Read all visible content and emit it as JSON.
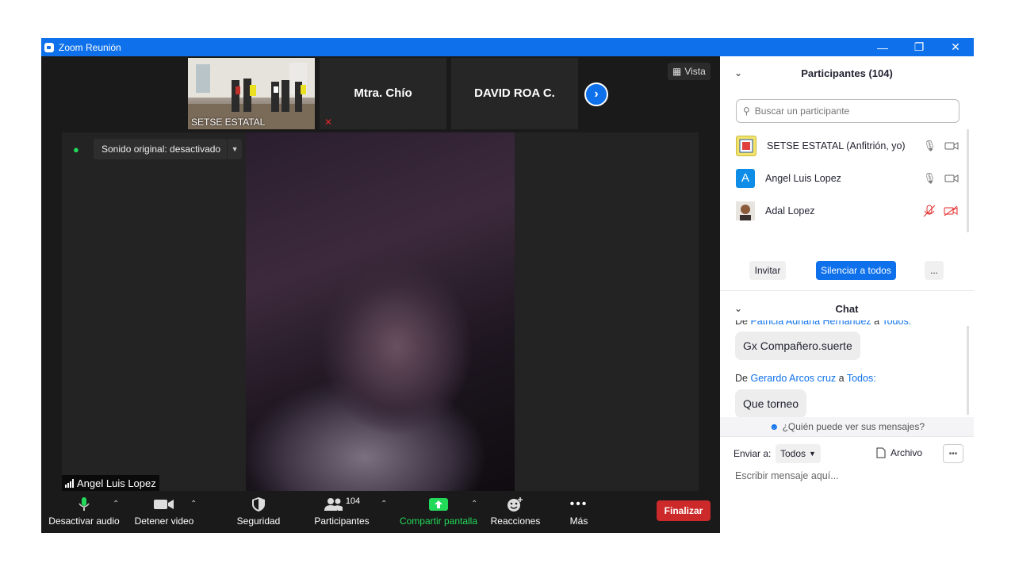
{
  "window": {
    "title": "Zoom Reunión"
  },
  "thumbnails": [
    {
      "label": "SETSE ESTATAL"
    },
    {
      "name": "Mtra. Chío"
    },
    {
      "name": "DAVID ROA C."
    }
  ],
  "view_button": {
    "label": "Vista"
  },
  "stage": {
    "sound_label": "Sonido original: desactivado",
    "speaker_name": "Angel Luis Lopez"
  },
  "toolbar": {
    "audio_label": "Desactivar audio",
    "video_label": "Detener video",
    "security_label": "Seguridad",
    "participants_label": "Participantes",
    "participants_count": "104",
    "share_label": "Compartir pantalla",
    "reactions_label": "Reacciones",
    "more_label": "Más",
    "end_label": "Finalizar"
  },
  "participants": {
    "header": "Participantes (104)",
    "search_placeholder": "Buscar un participante",
    "list": [
      {
        "name": "SETSE ESTATAL (Anfitrión, yo)",
        "avatar": "",
        "muted": false,
        "video_off": false
      },
      {
        "name": "Angel Luis Lopez",
        "avatar": "A",
        "muted": false,
        "video_off": false
      },
      {
        "name": "Adal Lopez",
        "avatar": "",
        "muted": true,
        "video_off": true
      }
    ],
    "invite_label": "Invitar",
    "mute_all_label": "Silenciar a todos",
    "more_label": "..."
  },
  "chat": {
    "header": "Chat",
    "messages": [
      {
        "prefix": "De",
        "sender": "Patricia Adriana Hernández",
        "to_word": "a",
        "recipient": "Todos:",
        "text": "Gx Compañero.suerte"
      },
      {
        "prefix": "De",
        "sender": "Gerardo Arcos cruz",
        "to_word": "a",
        "recipient": "Todos:",
        "text": "Que torneo"
      }
    ],
    "who_can_see": "¿Quién puede ver sus mensajes?",
    "send_to_label": "Enviar a:",
    "send_to_value": "Todos",
    "file_label": "Archivo",
    "input_placeholder": "Escribir mensaje aquí..."
  },
  "colors": {
    "brand": "#0e71eb",
    "end": "#cc2a2a",
    "share": "#23d959"
  }
}
